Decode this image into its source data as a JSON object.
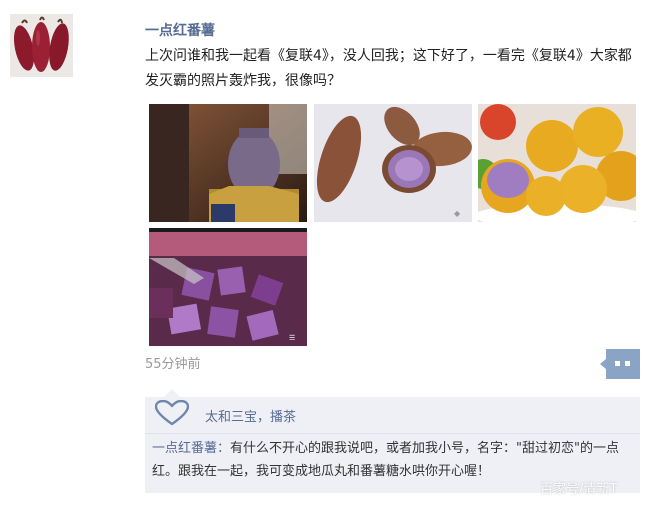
{
  "post": {
    "author": "一点红番薯",
    "text": "上次问谁和我一起看《复联4》，没人回我；这下好了，一看完《复联4》大家都发灭霸的照片轰炸我，很像吗？",
    "timestamp": "55分钟前",
    "photos": [
      {
        "icon": "thanos-photo"
      },
      {
        "icon": "purple-sweet-potato-photo"
      },
      {
        "icon": "sweet-potato-balls-photo"
      },
      {
        "icon": "purple-potato-dessert-photo"
      }
    ]
  },
  "likes": {
    "names": "太和三宝，播茶"
  },
  "comment": {
    "author": "一点红番薯",
    "separator": "：",
    "text": "有什么不开心的跟我说吧，或者加我小号，名字：\"甜过初恋\"的一点红。跟我在一起，我可变成地瓜丸和番薯糖水哄你开心喔！"
  },
  "watermark": "百家号/清新T",
  "colors": {
    "link": "#576b95",
    "comment_bg": "#eff0f6"
  }
}
